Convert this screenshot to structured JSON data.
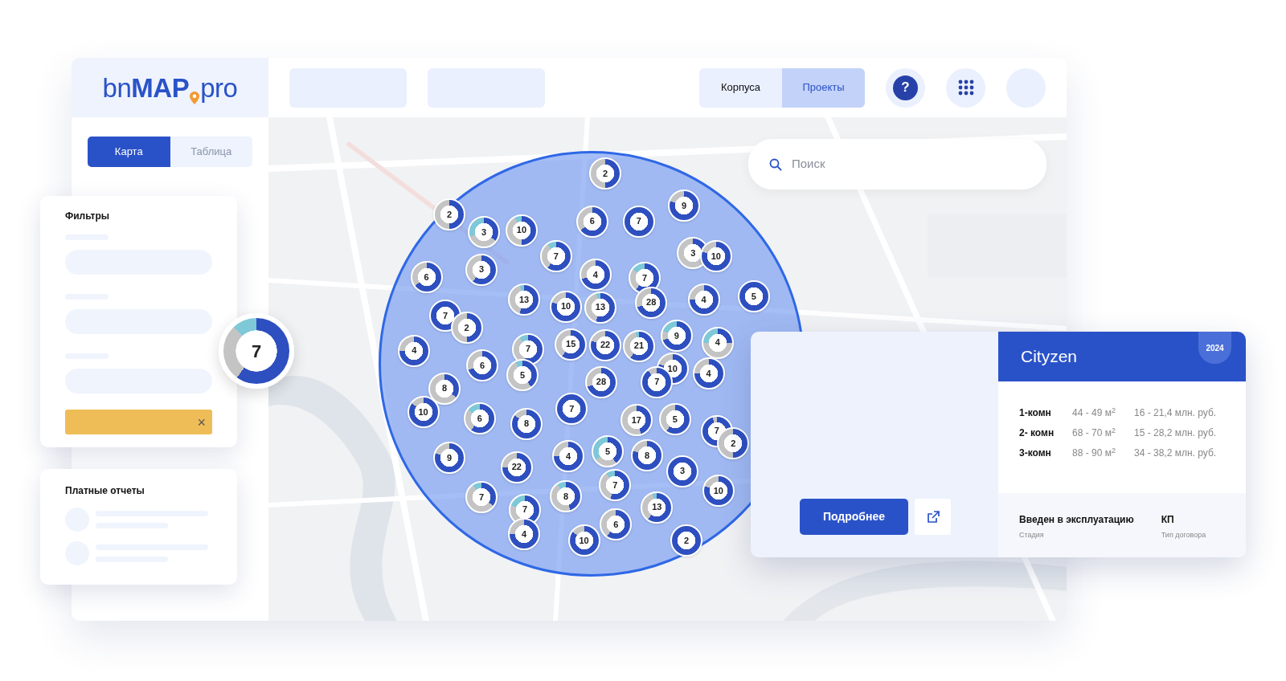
{
  "logo": {
    "prefix": "bn",
    "main": "MAP",
    "suffix": "pro"
  },
  "view_toggle": [
    {
      "label": "Корпуса",
      "selected": false
    },
    {
      "label": "Проекты",
      "selected": true
    }
  ],
  "help_button": {
    "label": "?"
  },
  "sidebar_tabs": [
    {
      "label": "Карта",
      "selected": true
    },
    {
      "label": "Таблица",
      "selected": false
    }
  ],
  "filters_panel": {
    "title": "Фильтры",
    "reset_icon": "×"
  },
  "reports_panel": {
    "title": "Платные отчеты"
  },
  "summary_marker": {
    "label": "7"
  },
  "search": {
    "placeholder": "Поиск"
  },
  "markers": [
    {
      "label": "2"
    },
    {
      "label": "9"
    },
    {
      "label": "2"
    },
    {
      "label": "6"
    },
    {
      "label": "7"
    },
    {
      "label": "3"
    },
    {
      "label": "10"
    },
    {
      "label": "7"
    },
    {
      "label": "3"
    },
    {
      "label": "10"
    },
    {
      "label": "6"
    },
    {
      "label": "3"
    },
    {
      "label": "4"
    },
    {
      "label": "7"
    },
    {
      "label": "13"
    },
    {
      "label": "28"
    },
    {
      "label": "4"
    },
    {
      "label": "5"
    },
    {
      "label": "10"
    },
    {
      "label": "13"
    },
    {
      "label": "7"
    },
    {
      "label": "2"
    },
    {
      "label": "9"
    },
    {
      "label": "4"
    },
    {
      "label": "7"
    },
    {
      "label": "15"
    },
    {
      "label": "22"
    },
    {
      "label": "21"
    },
    {
      "label": "4"
    },
    {
      "label": "6"
    },
    {
      "label": "10"
    },
    {
      "label": "4"
    },
    {
      "label": "5"
    },
    {
      "label": "28"
    },
    {
      "label": "7"
    },
    {
      "label": "8"
    },
    {
      "label": "10"
    },
    {
      "label": "7"
    },
    {
      "label": "6"
    },
    {
      "label": "8"
    },
    {
      "label": "17"
    },
    {
      "label": "5"
    },
    {
      "label": "7"
    },
    {
      "label": "5"
    },
    {
      "label": "2"
    },
    {
      "label": "9"
    },
    {
      "label": "4"
    },
    {
      "label": "8"
    },
    {
      "label": "22"
    },
    {
      "label": "3"
    },
    {
      "label": "7"
    },
    {
      "label": "10"
    },
    {
      "label": "7"
    },
    {
      "label": "8"
    },
    {
      "label": "7"
    },
    {
      "label": "13"
    },
    {
      "label": "6"
    },
    {
      "label": "4"
    },
    {
      "label": "10"
    },
    {
      "label": "2"
    }
  ],
  "project_card": {
    "details_button": "Подробнее",
    "title": "Cityzen",
    "year": "2024",
    "rows": [
      {
        "rooms": "1-комн",
        "area": "44 - 49 м$^{2}$",
        "price": "16 - 21,4 млн. руб."
      },
      {
        "rooms": "2- комн",
        "area": "68 - 70 м$^{2}$",
        "price": "15 - 28,2 млн. руб."
      },
      {
        "rooms": "3-комн",
        "area": "88 - 90 м$^{2}$",
        "price": "34 - 38,2 млн. руб."
      }
    ],
    "stage": {
      "value": "Введен в эксплуатацию",
      "label": "Стадия"
    },
    "contract": {
      "value": "КП",
      "label": "Тип договора"
    }
  }
}
